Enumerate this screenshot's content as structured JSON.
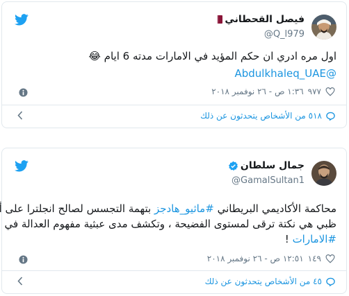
{
  "colors": {
    "accent": "#1da1f2",
    "link": "#1b95e0",
    "muted": "#657786",
    "border": "#e1e8ed",
    "text": "#14171a"
  },
  "tweets": [
    {
      "user": {
        "name": "فيصل القحطاني",
        "handle": "@Q_l979",
        "flag_icon": "qatar-flag-icon"
      },
      "text_line1": "اول مره ادري ان حكم المؤيد في الامارات مدته 6 ايام",
      "emoji": "😂",
      "mention": "@Abdulkhaleq_UAE",
      "likes": "٩٧٧",
      "timestamp": "١:٣٦ ص - ٢٦ نوفمبر ٢٠١٨",
      "replies_text": "٥١٨ من الأشخاص يتحدثون عن ذلك"
    },
    {
      "user": {
        "name": "جمال سلطان",
        "handle": "@GamalSultan1",
        "verified": true
      },
      "line1_pre": "محاكمة الأكاديمي البريطاني",
      "line1_hashtag": "#ماثيو_هادجز",
      "line1_post": "بتهمة التجسس لصالح انجلترا على أبو",
      "line2": "ظبي هي نكتة ترقى لمستوى الفضيحة ، وتكشف مدى عبثية مفهوم العدالة في",
      "line3_hashtag": "#الامارات",
      "line3_post": "!",
      "likes": "١٤٩",
      "timestamp": "١٢:٥١ ص - ٢٦ نوفمبر ٢٠١٨",
      "replies_text": "٤٥ من الأشخاص يتحدثون عن ذلك"
    }
  ]
}
